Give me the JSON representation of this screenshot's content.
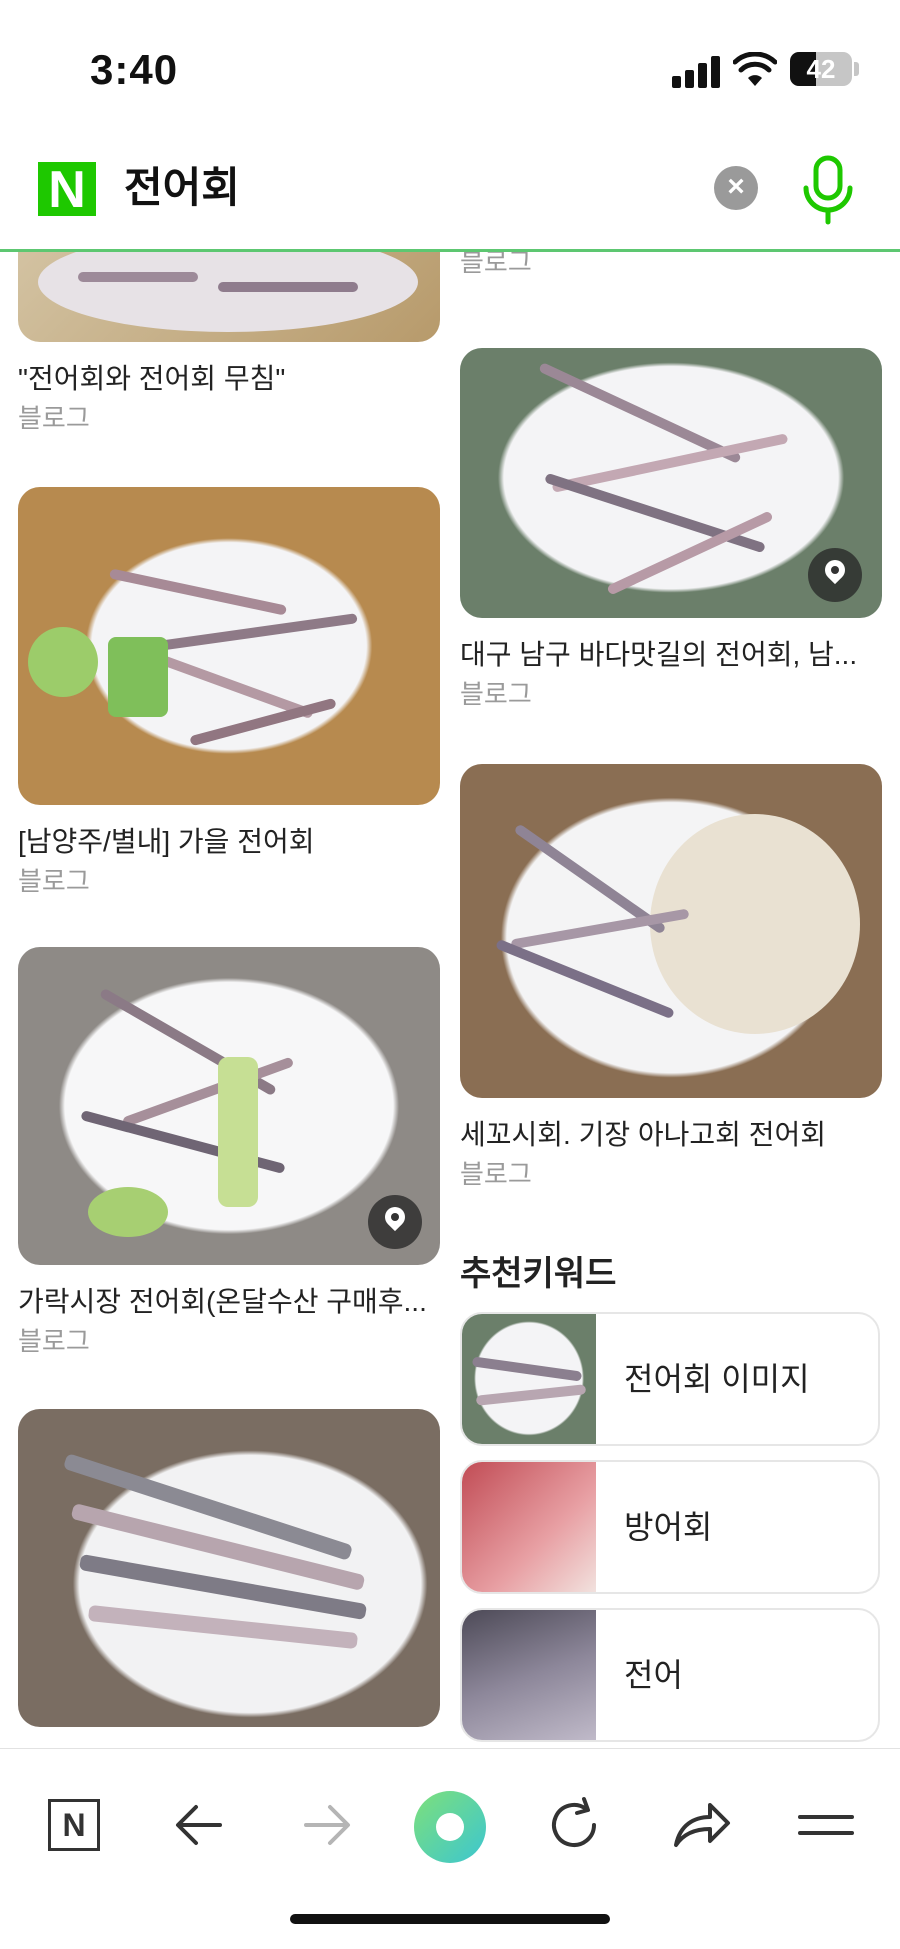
{
  "status_bar": {
    "time": "3:40",
    "battery": "42"
  },
  "search": {
    "query": "전어회",
    "logo": "N"
  },
  "results": {
    "left_column": [
      {
        "title": "\"전어회와 전어회 무침\"",
        "source": "블로그"
      },
      {
        "title": "[남양주/별내] 가을 전어회",
        "source": "블로그"
      },
      {
        "title": "가락시장 전어회(온달수산 구매후...",
        "source": "블로그"
      }
    ],
    "right_column": [
      {
        "source": "블로그"
      },
      {
        "title": "대구 남구 바다맛길의 전어회, 남...",
        "source": "블로그"
      },
      {
        "title": "세꼬시회. 기장 아나고회 전어회",
        "source": "블로그"
      }
    ]
  },
  "recommended": {
    "title": "추천키워드",
    "items": [
      {
        "label": "전어회 이미지"
      },
      {
        "label": "방어회"
      },
      {
        "label": "전어"
      }
    ]
  },
  "toolbar": {
    "home_label": "N"
  },
  "colors": {
    "accent": "#5dc771",
    "naver_green": "#1ec800"
  }
}
